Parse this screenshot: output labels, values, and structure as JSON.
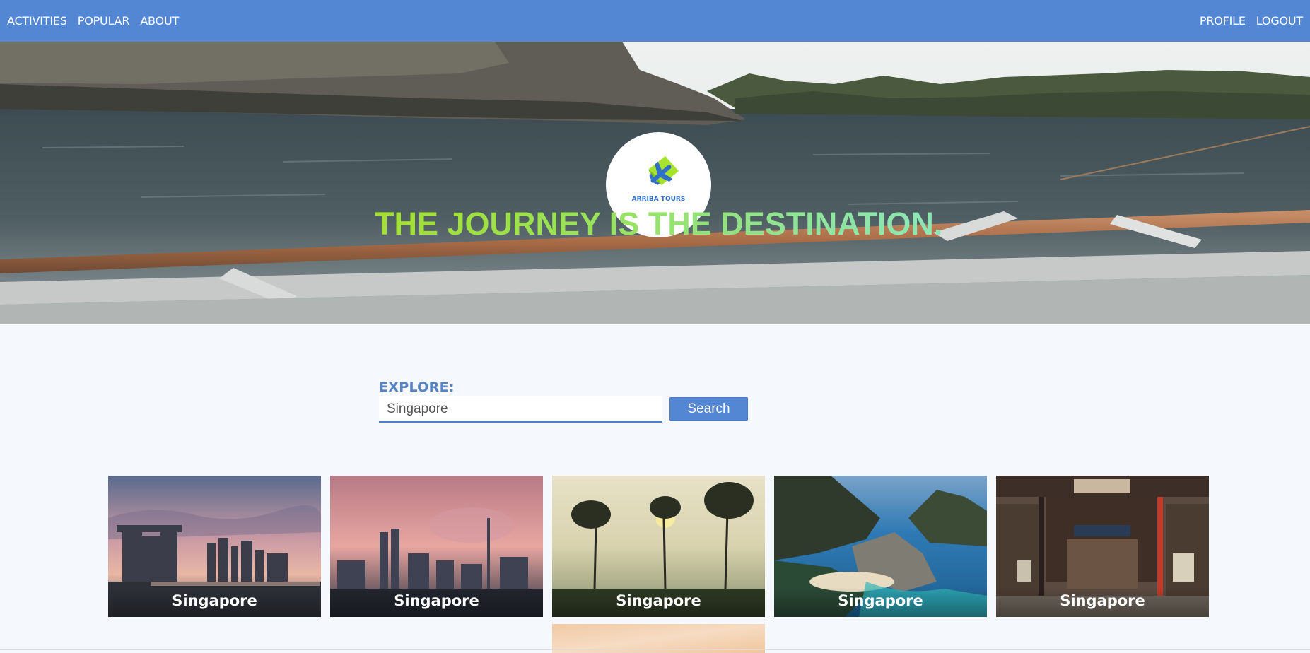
{
  "nav": {
    "left_items": [
      {
        "label": "ACTIVITIES"
      },
      {
        "label": "POPULAR"
      },
      {
        "label": "ABOUT"
      }
    ],
    "right_items": [
      {
        "label": "PROFILE"
      },
      {
        "label": "LOGOUT"
      }
    ]
  },
  "hero": {
    "logo_text": "ARRIBA TOURS",
    "logo_icon": "airplane-icon",
    "headline": "THE JOURNEY IS THE DESTINATION."
  },
  "search": {
    "label": "EXPLORE:",
    "value": "Singapore",
    "button_label": "Search"
  },
  "destinations": [
    {
      "name": "Singapore"
    },
    {
      "name": "Singapore"
    },
    {
      "name": "Singapore"
    },
    {
      "name": "Singapore"
    },
    {
      "name": "Singapore"
    }
  ],
  "colors": {
    "nav_background": "#5387d4",
    "accent": "#5387d4",
    "headline_green": "#98e25d",
    "page_background": "#f5f9fd"
  }
}
